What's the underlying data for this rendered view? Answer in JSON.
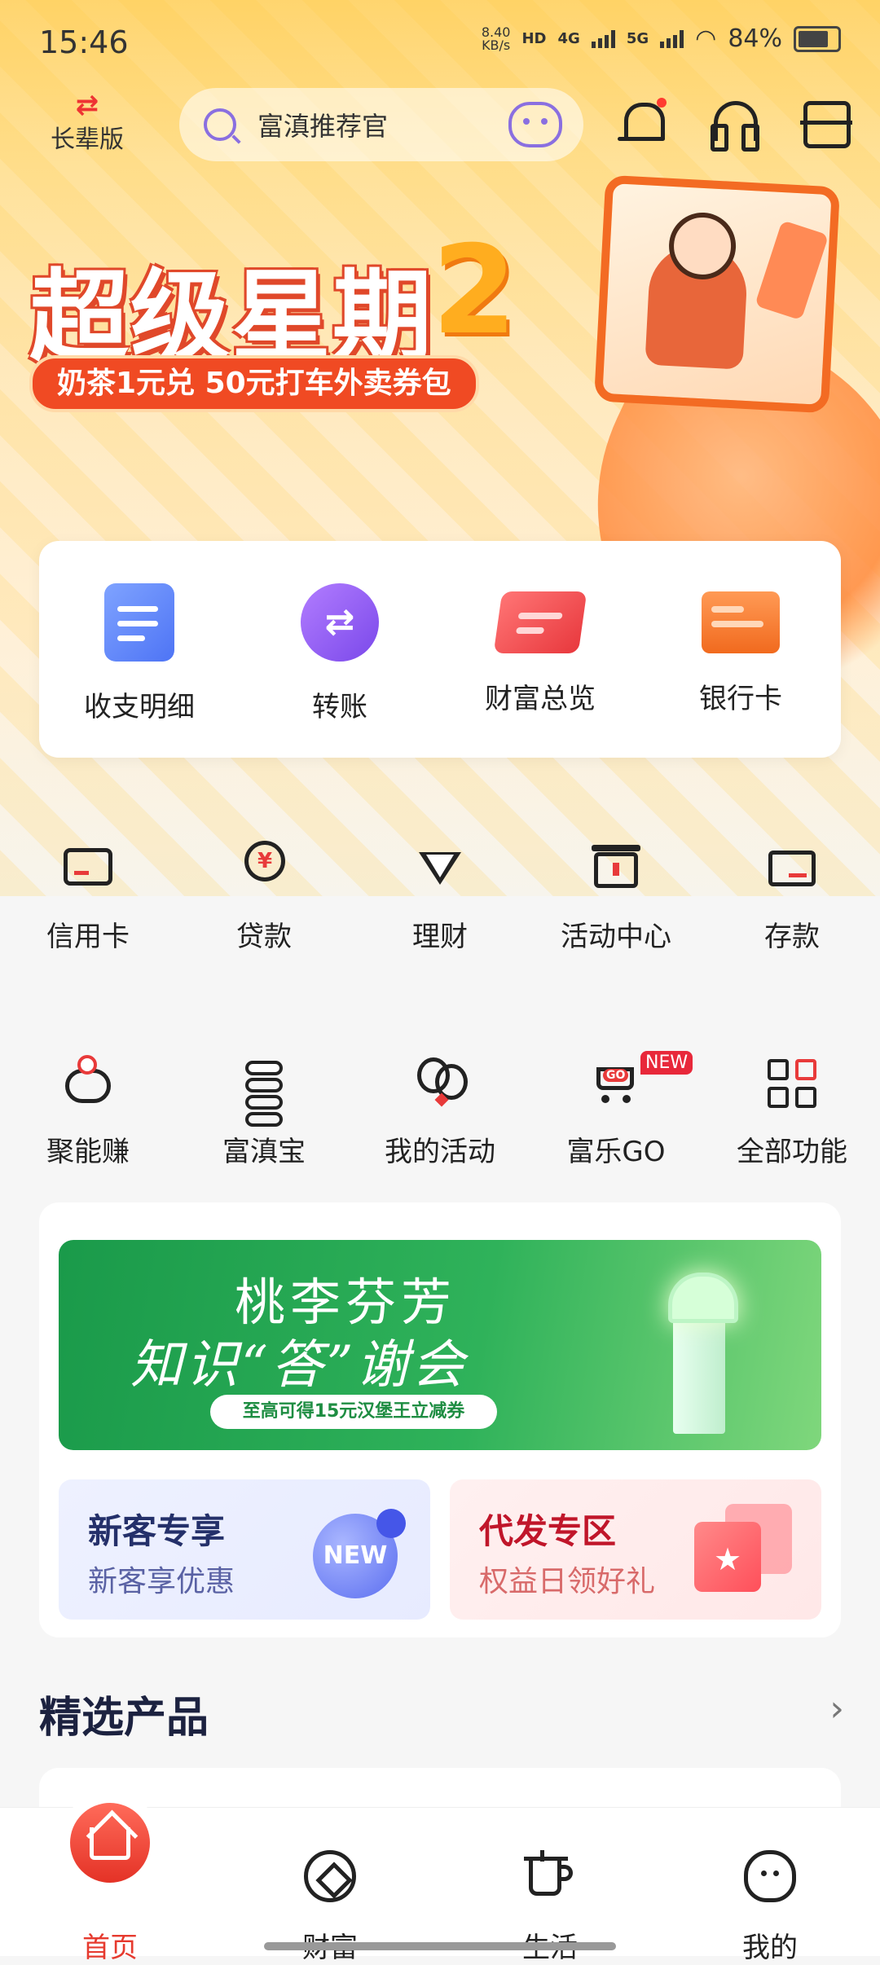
{
  "status_bar": {
    "time": "15:46",
    "net_speed": "8.40",
    "net_unit": "KB/s",
    "hd": "HD",
    "sim1": "4G",
    "sim2": "5G",
    "battery": "84%"
  },
  "top_bar": {
    "elder_mode_label": "长辈版",
    "search_placeholder": "富滇推荐官"
  },
  "banner": {
    "title": "超级星期",
    "title_number": "2",
    "subtitle": "奶茶1元兑 50元打车外卖券包"
  },
  "quick_actions": [
    {
      "label": "收支明细",
      "icon": "statement-icon"
    },
    {
      "label": "转账",
      "icon": "transfer-icon"
    },
    {
      "label": "财富总览",
      "icon": "wealth-overview-icon"
    },
    {
      "label": "银行卡",
      "icon": "bank-card-icon"
    }
  ],
  "grid_row1": [
    {
      "label": "信用卡",
      "icon": "credit-card-icon"
    },
    {
      "label": "贷款",
      "icon": "loan-icon"
    },
    {
      "label": "理财",
      "icon": "diamond-icon"
    },
    {
      "label": "活动中心",
      "icon": "gift-icon"
    },
    {
      "label": "存款",
      "icon": "deposit-icon"
    }
  ],
  "grid_row2": [
    {
      "label": "聚能赚",
      "icon": "piggy-bank-icon"
    },
    {
      "label": "富滇宝",
      "icon": "coins-icon"
    },
    {
      "label": "我的活动",
      "icon": "balloon-icon"
    },
    {
      "label": "富乐GO",
      "icon": "cart-icon",
      "badge": "NEW",
      "icon_text": "GO"
    },
    {
      "label": "全部功能",
      "icon": "all-apps-icon"
    }
  ],
  "green_banner": {
    "line1": "桃李芬芳",
    "line2": "知识“答”谢会",
    "pill": "至高可得15元汉堡王立减券"
  },
  "promo_cards": [
    {
      "title": "新客专享",
      "subtitle": "新客享优惠",
      "icon_text": "NEW"
    },
    {
      "title": "代发专区",
      "subtitle": "权益日领好礼"
    }
  ],
  "featured": {
    "title": "精选产品",
    "more": "›"
  },
  "bottom_nav": [
    {
      "label": "首页",
      "active": true
    },
    {
      "label": "财富",
      "active": false
    },
    {
      "label": "生活",
      "active": false
    },
    {
      "label": "我的",
      "active": false
    }
  ],
  "colors": {
    "accent_red": "#e63a2e",
    "banner_orange": "#f04a23",
    "green_banner": "#2fb25a"
  }
}
